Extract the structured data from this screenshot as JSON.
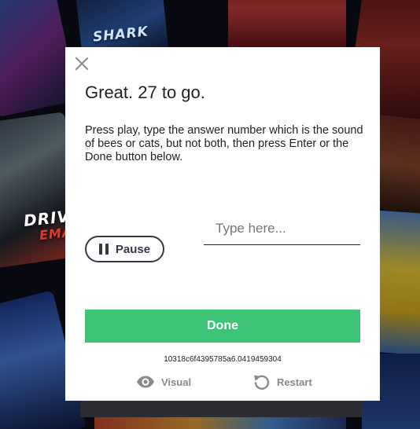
{
  "dialog": {
    "title": "Great. 27 to go.",
    "instructions": "Press play, type the answer number which is the sound of bees or cats, but not both, then press Enter or the Done button below.",
    "answer_input": {
      "placeholder": "Type here...",
      "value": ""
    },
    "pause_label": "Pause",
    "done_label": "Done",
    "session_id": "10318c6f4395785a6.0419459304",
    "footer": {
      "visual_label": "Visual",
      "restart_label": "Restart"
    }
  },
  "background": {
    "labels": {
      "shark": "SHARK",
      "drive": "DRIV",
      "drive2": "EMA"
    }
  },
  "colors": {
    "accent_done": "#3ec479",
    "text_dark": "#222222",
    "button_outline": "#333a45",
    "muted": "#8a8a8a"
  },
  "icons": [
    "close-icon",
    "pause-icon",
    "eye-icon",
    "restart-icon"
  ]
}
